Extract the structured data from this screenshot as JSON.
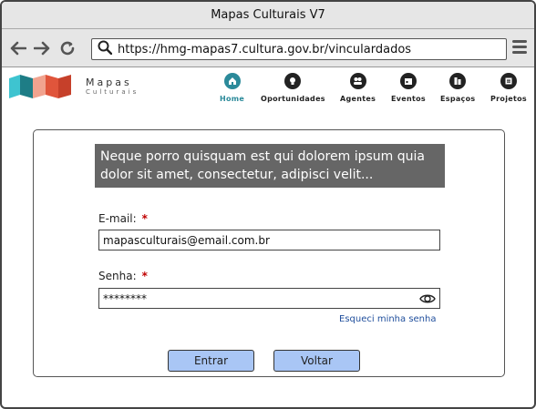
{
  "window": {
    "title": "Mapas Culturais V7"
  },
  "browser": {
    "url": "https://hmg-mapas7.cultura.gov.br/vinculardados",
    "back_icon": "arrow-left-icon",
    "forward_icon": "arrow-right-icon",
    "reload_icon": "reload-icon",
    "search_icon": "search-icon",
    "menu_icon": "hamburger-menu-icon"
  },
  "brand": {
    "title": "Mapas",
    "subtitle": "Culturais"
  },
  "nav": {
    "items": [
      {
        "label": "Home",
        "icon": "home-icon",
        "active": true
      },
      {
        "label": "Oportunidades",
        "icon": "lightbulb-icon",
        "active": false
      },
      {
        "label": "Agentes",
        "icon": "people-icon",
        "active": false
      },
      {
        "label": "Eventos",
        "icon": "calendar-icon",
        "active": false
      },
      {
        "label": "Espaços",
        "icon": "building-icon",
        "active": false
      },
      {
        "label": "Projetos",
        "icon": "folder-icon",
        "active": false
      }
    ]
  },
  "form": {
    "banner": "Neque porro quisquam est qui dolorem ipsum quia dolor sit amet, consectetur, adipisci velit...",
    "email_label": "E-mail:",
    "email_value": "mapasculturais@email.com.br",
    "password_label": "Senha:",
    "password_value": "********",
    "required_mark": "*",
    "forgot_link": "Esqueci minha senha",
    "submit_label": "Entrar",
    "back_label": "Voltar"
  },
  "colors": {
    "accent": "#2b8a9a",
    "button_bg": "#a9c6f5",
    "banner_bg": "#666666",
    "link": "#1f4e9c",
    "required": "#c00000"
  }
}
